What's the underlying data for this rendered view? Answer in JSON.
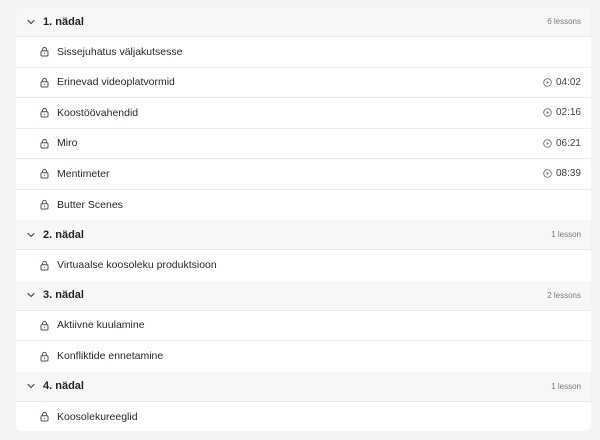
{
  "sections": [
    {
      "title": "1. nädal",
      "count": "6 lessons",
      "lessons": [
        {
          "title": "Sissejuhatus väljakutsesse",
          "duration": ""
        },
        {
          "title": "Erinevad videoplatvormid",
          "duration": "04:02"
        },
        {
          "title": "Koostöövahendid",
          "duration": "02:16"
        },
        {
          "title": "Miro",
          "duration": "06:21"
        },
        {
          "title": "Mentimeter",
          "duration": "08:39"
        },
        {
          "title": "Butter Scenes",
          "duration": ""
        }
      ]
    },
    {
      "title": "2. nädal",
      "count": "1 lesson",
      "lessons": [
        {
          "title": "Virtuaalse koosoleku produktsioon",
          "duration": ""
        }
      ]
    },
    {
      "title": "3. nädal",
      "count": "2 lessons",
      "lessons": [
        {
          "title": "Aktiivne kuulamine",
          "duration": ""
        },
        {
          "title": "Konfliktide ennetamine",
          "duration": ""
        }
      ]
    },
    {
      "title": "4. nädal",
      "count": "1 lesson",
      "lessons": [
        {
          "title": "Koosolekureeglid",
          "duration": ""
        }
      ]
    }
  ],
  "icons": {
    "section_toggle": "chevron-down-icon",
    "lesson": "lock-icon",
    "duration": "play-circle-icon"
  }
}
